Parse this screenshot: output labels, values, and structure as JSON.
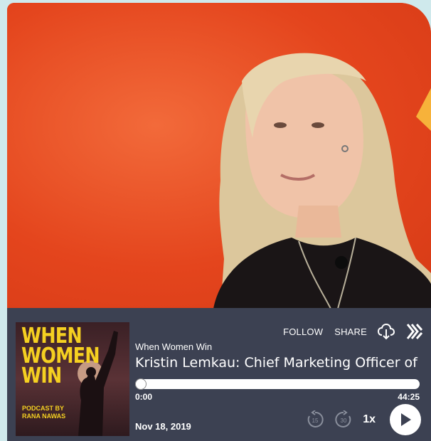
{
  "podcast": {
    "show_name": "When Women Win",
    "episode_title": "Kristin Lemkau: Chief Marketing Officer of J",
    "date": "Nov 18, 2019",
    "cover": {
      "title": "WHEN\nWOMEN\nWIN",
      "subtitle": "PODCAST BY RANA NAWAS"
    }
  },
  "actions": {
    "follow_label": "FOLLOW",
    "share_label": "SHARE"
  },
  "playback": {
    "current_time": "0:00",
    "total_time": "44:25",
    "progress_fraction": 0,
    "speed_label": "1x",
    "skip_back_seconds": "15",
    "skip_forward_seconds": "30"
  },
  "colors": {
    "player_bg": "#3c4152",
    "hero_bg": "#e8471f",
    "cover_accent": "#f5d021"
  },
  "icons": {
    "download": "cloud-download-icon",
    "brand": "brand-logo-icon",
    "play": "play-icon",
    "skip_back": "rewind-15-icon",
    "skip_forward": "forward-30-icon"
  }
}
